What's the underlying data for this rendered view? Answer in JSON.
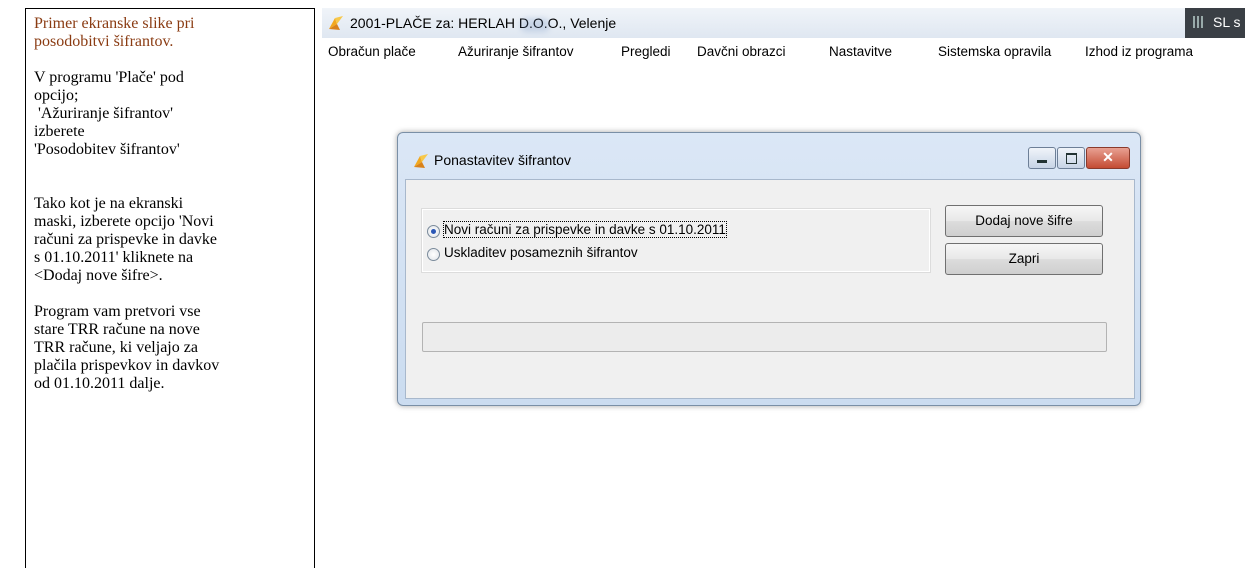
{
  "doc": {
    "title_line1": "Primer ekranske slike pri",
    "title_line2": "posodobitvi šifrantov.",
    "p1_line1": "V programu 'Plače' pod",
    "p1_line2": "opcijo;",
    "p1_line3": " 'Ažuriranje šifrantov'",
    "p1_line4": "izberete",
    "p1_line5": "'Posodobitev šifrantov'",
    "p2_line1": "Tako kot je na ekranski",
    "p2_line2": "maski, izberete opcijo 'Novi",
    "p2_line3": "računi za prispevke in davke",
    "p2_line4": "s 01.10.2011' kliknete na",
    "p2_line5": "<Dodaj nove šifre>.",
    "p3_line1": "Program vam pretvori vse",
    "p3_line2": "stare TRR račune na nove",
    "p3_line3": "TRR račune, ki veljajo za",
    "p3_line4": "plačila prispevkov in davkov",
    "p3_line5": "od 01.10.2011 dalje."
  },
  "app": {
    "title": "2001-PLAČE za: HERLAH D.O.O., Velenje",
    "badge_text": "SL s"
  },
  "menu": [
    "Obračun plače",
    "Ažuriranje šifrantov",
    "Pregledi",
    "Davčni obrazci",
    "Nastavitve",
    "Sistemska opravila",
    "Izhod iz programa"
  ],
  "dialog": {
    "title": "Ponastavitev šifrantov",
    "options": [
      {
        "label": "Novi računi za prispevke in davke s 01.10.2011",
        "checked": true
      },
      {
        "label": "Uskladitev posameznih šifrantov",
        "checked": false
      }
    ],
    "buttons": {
      "add": "Dodaj nove šifre",
      "close": "Zapri"
    },
    "progress": 0
  },
  "colors": {
    "doc_title": "#8a3b12",
    "accent": "#2b57b5",
    "close_button": "#c44b33"
  },
  "icons": {
    "app": "app-logo-icon",
    "minimize": "minimize-icon",
    "maximize": "maximize-icon",
    "close": "close-icon"
  }
}
